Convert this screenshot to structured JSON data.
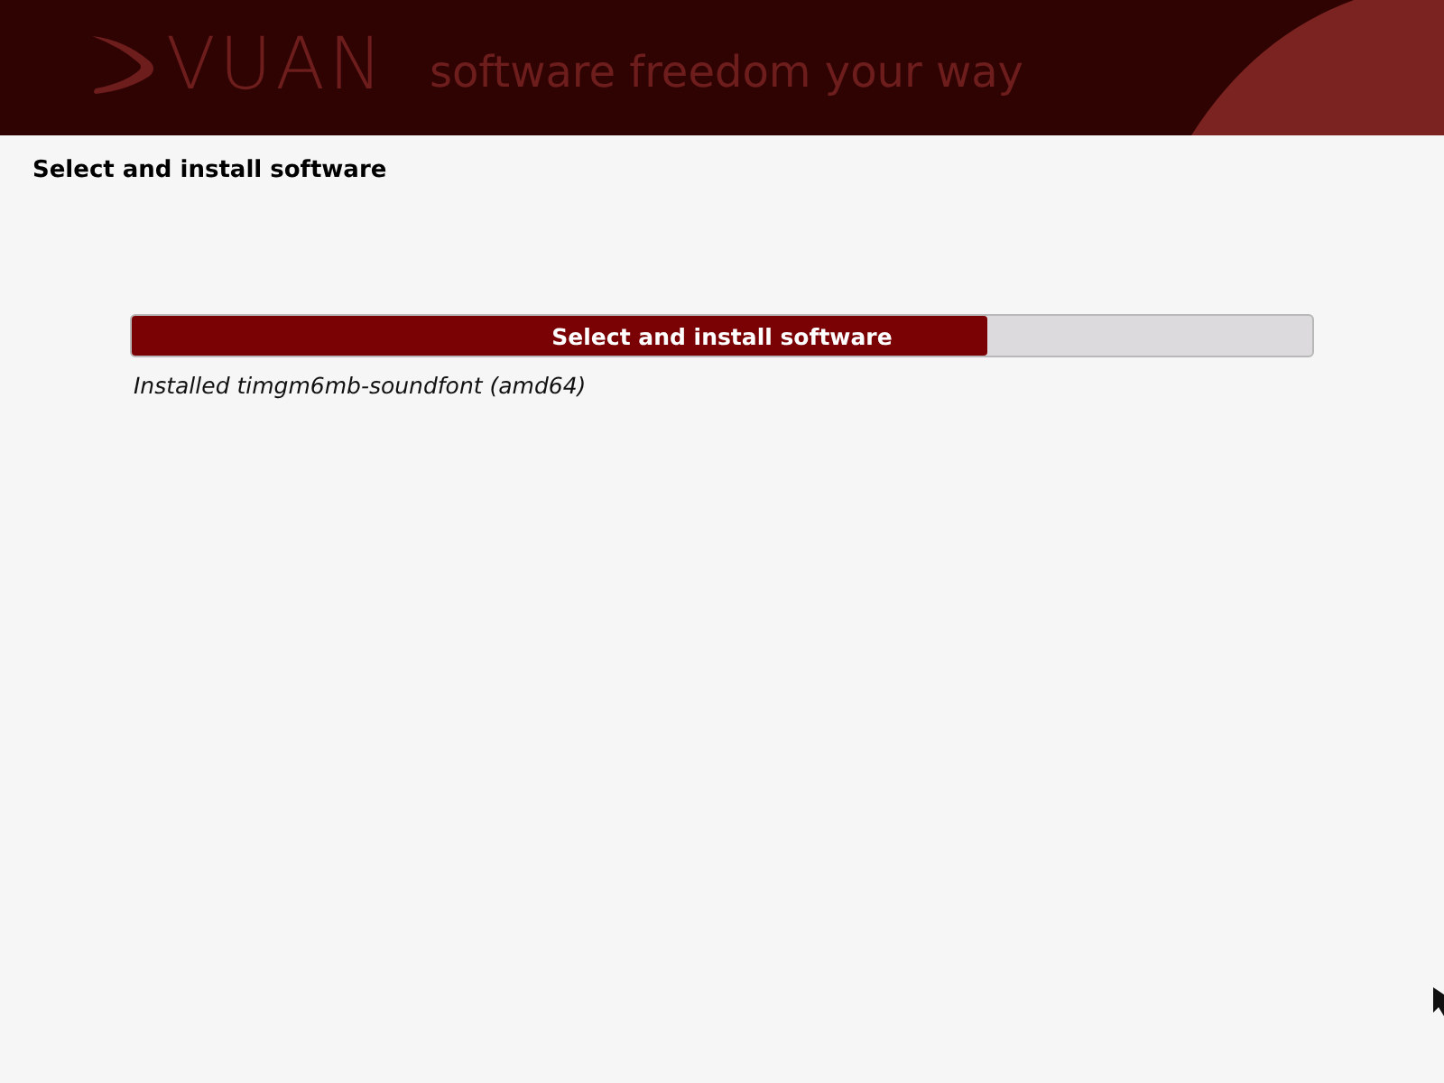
{
  "header": {
    "logo": "VUAN",
    "tagline": "software freedom your way"
  },
  "step_title": "Select and install software",
  "progress": {
    "label": "Select and install software",
    "level": 0.725,
    "status": "Installed timgm6mb-soundfont (amd64)"
  }
}
